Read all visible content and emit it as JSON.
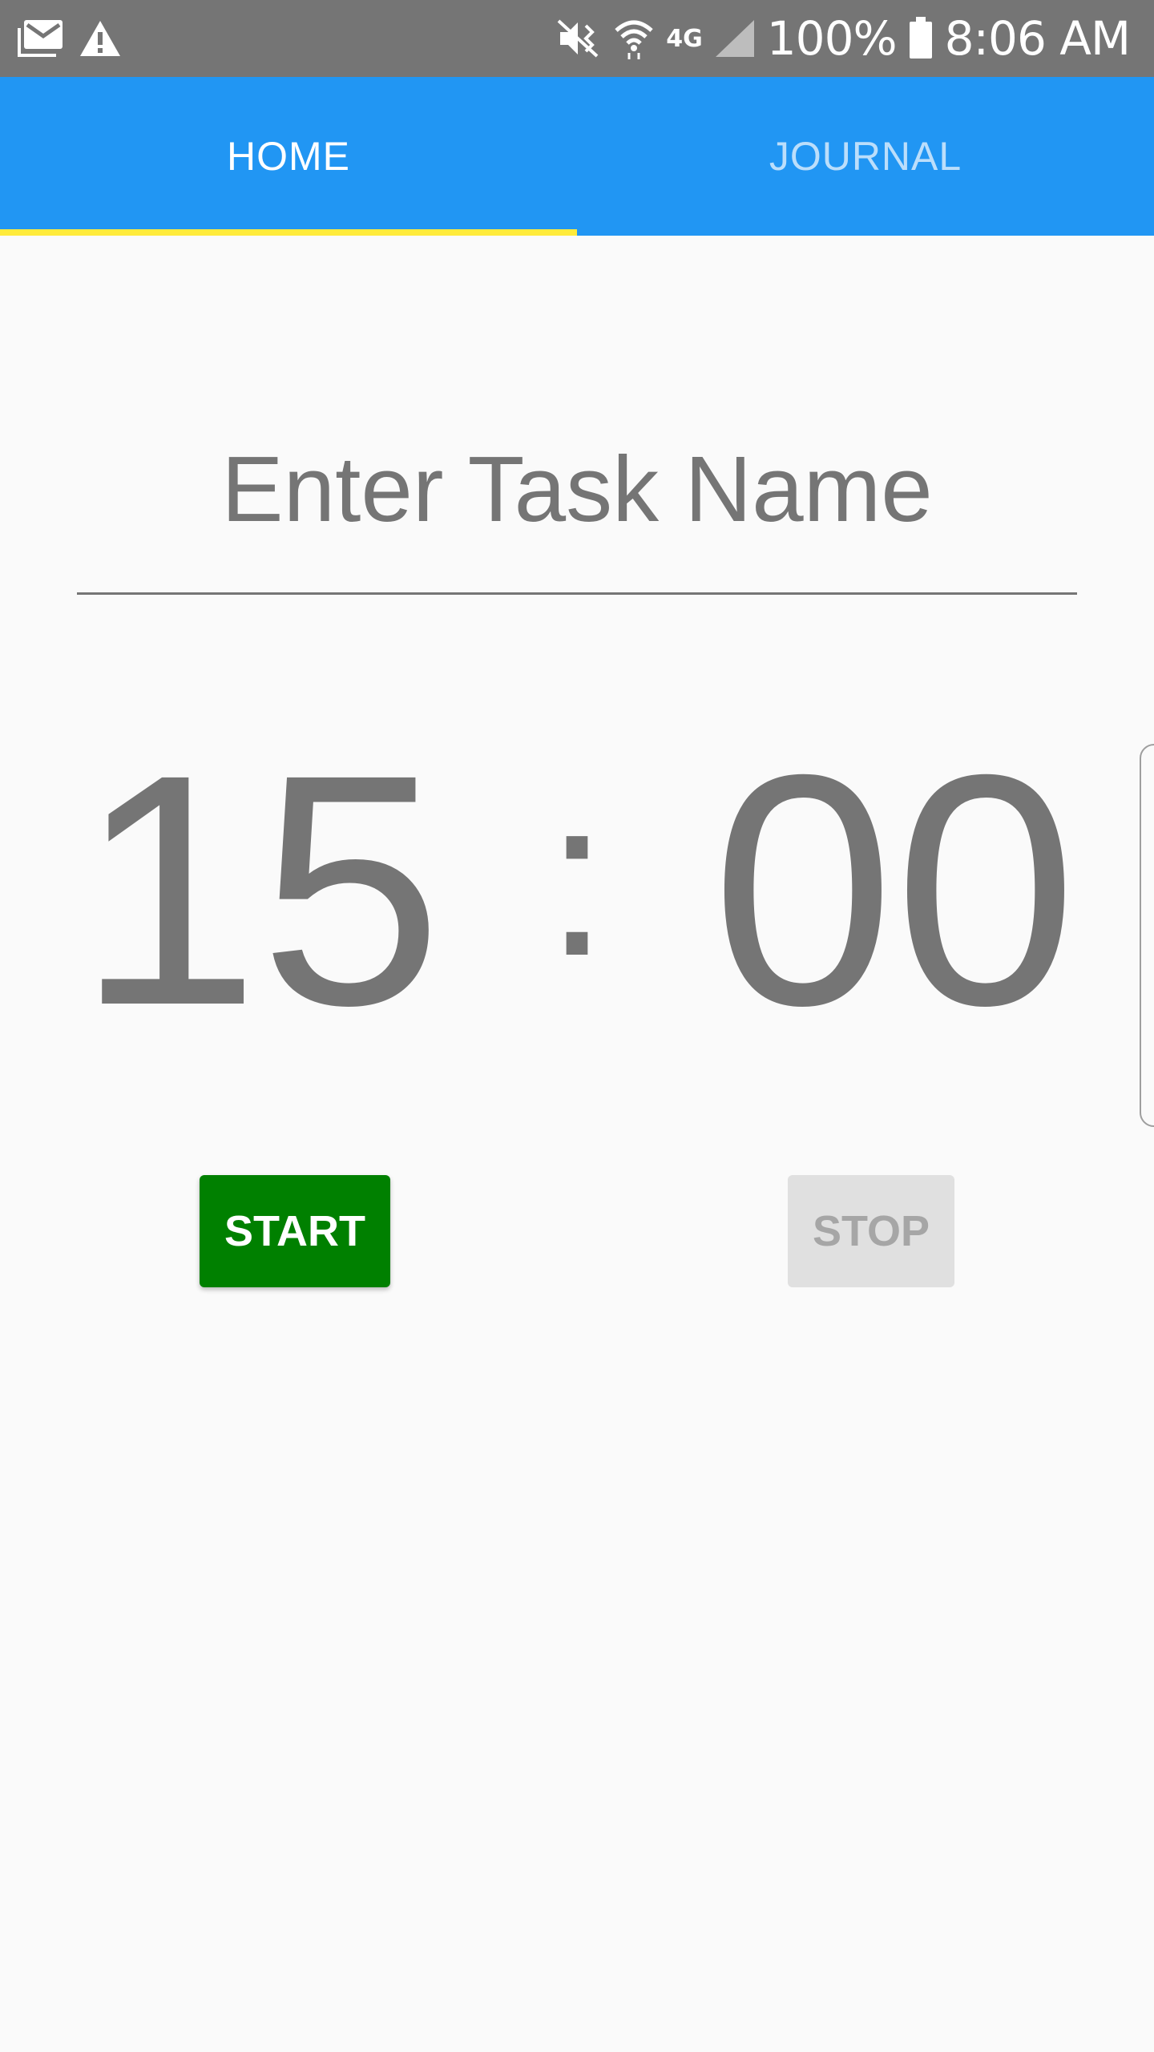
{
  "status_bar": {
    "battery_percent": "100%",
    "time": "8:06 AM",
    "network_type": "4G",
    "icons": [
      "gmail-icon",
      "warning-icon",
      "vibrate-mute-icon",
      "wifi-icon",
      "lte-icon",
      "signal-icon",
      "battery-icon"
    ]
  },
  "tabs": [
    {
      "label": "HOME",
      "active": true
    },
    {
      "label": "JOURNAL",
      "active": false
    }
  ],
  "task_input": {
    "placeholder": "Enter Task Name",
    "value": ""
  },
  "timer": {
    "minutes": "15",
    "separator": ":",
    "seconds": "00"
  },
  "buttons": {
    "start_label": "START",
    "stop_label": "STOP"
  },
  "colors": {
    "status_bar": "#757575",
    "tab_bar": "#2196f3",
    "tab_indicator": "#ffeb3b",
    "start_button": "#008000",
    "stop_button_disabled": "#e0e0e0",
    "text_gray": "#757575"
  }
}
